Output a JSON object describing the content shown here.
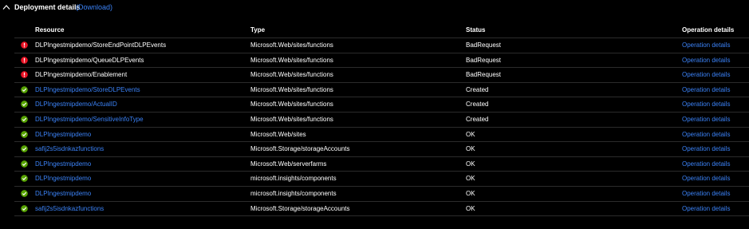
{
  "header": {
    "title": "Deployment details",
    "download_label": "(Download)"
  },
  "table": {
    "columns": {
      "resource": "Resource",
      "type": "Type",
      "status": "Status",
      "operation": "Operation details"
    },
    "rows": [
      {
        "icon": "error-icon",
        "resource": "DLPIngestmipdemo/StoreEndPointDLPEvents",
        "resource_link": false,
        "type": "Microsoft.Web/sites/functions",
        "status": "BadRequest",
        "operation": "Operation details"
      },
      {
        "icon": "error-icon",
        "resource": "DLPIngestmipdemo/QueueDLPEvents",
        "resource_link": false,
        "type": "Microsoft.Web/sites/functions",
        "status": "BadRequest",
        "operation": "Operation details"
      },
      {
        "icon": "error-icon",
        "resource": "DLPIngestmipdemo/Enablement",
        "resource_link": false,
        "type": "Microsoft.Web/sites/functions",
        "status": "BadRequest",
        "operation": "Operation details"
      },
      {
        "icon": "success-icon",
        "resource": "DLPIngestmipdemo/StoreDLPEvents",
        "resource_link": true,
        "type": "Microsoft.Web/sites/functions",
        "status": "Created",
        "operation": "Operation details"
      },
      {
        "icon": "success-icon",
        "resource": "DLPIngestmipdemo/ActualID",
        "resource_link": true,
        "type": "Microsoft.Web/sites/functions",
        "status": "Created",
        "operation": "Operation details"
      },
      {
        "icon": "success-icon",
        "resource": "DLPIngestmipdemo/SensitiveInfoType",
        "resource_link": true,
        "type": "Microsoft.Web/sites/functions",
        "status": "Created",
        "operation": "Operation details"
      },
      {
        "icon": "success-icon",
        "resource": "DLPIngestmipdemo",
        "resource_link": true,
        "type": "Microsoft.Web/sites",
        "status": "OK",
        "operation": "Operation details"
      },
      {
        "icon": "success-icon",
        "resource": "safij2s5isdnkazfunctions",
        "resource_link": true,
        "type": "Microsoft.Storage/storageAccounts",
        "status": "OK",
        "operation": "Operation details"
      },
      {
        "icon": "success-icon",
        "resource": "DLPIngestmipdemo",
        "resource_link": true,
        "type": "Microsoft.Web/serverfarms",
        "status": "OK",
        "operation": "Operation details"
      },
      {
        "icon": "success-icon",
        "resource": "DLPIngestmipdemo",
        "resource_link": true,
        "type": "microsoft.insights/components",
        "status": "OK",
        "operation": "Operation details"
      },
      {
        "icon": "success-icon",
        "resource": "DLPIngestmipdemo",
        "resource_link": true,
        "type": "microsoft.insights/components",
        "status": "OK",
        "operation": "Operation details"
      },
      {
        "icon": "success-icon",
        "resource": "safij2s5isdnkazfunctions",
        "resource_link": true,
        "type": "Microsoft.Storage/storageAccounts",
        "status": "OK",
        "operation": "Operation details"
      }
    ]
  },
  "colors": {
    "background": "#000000",
    "link": "#3b82f6",
    "error": "#e81123",
    "success": "#57a300",
    "divider": "#2b2b2b"
  }
}
